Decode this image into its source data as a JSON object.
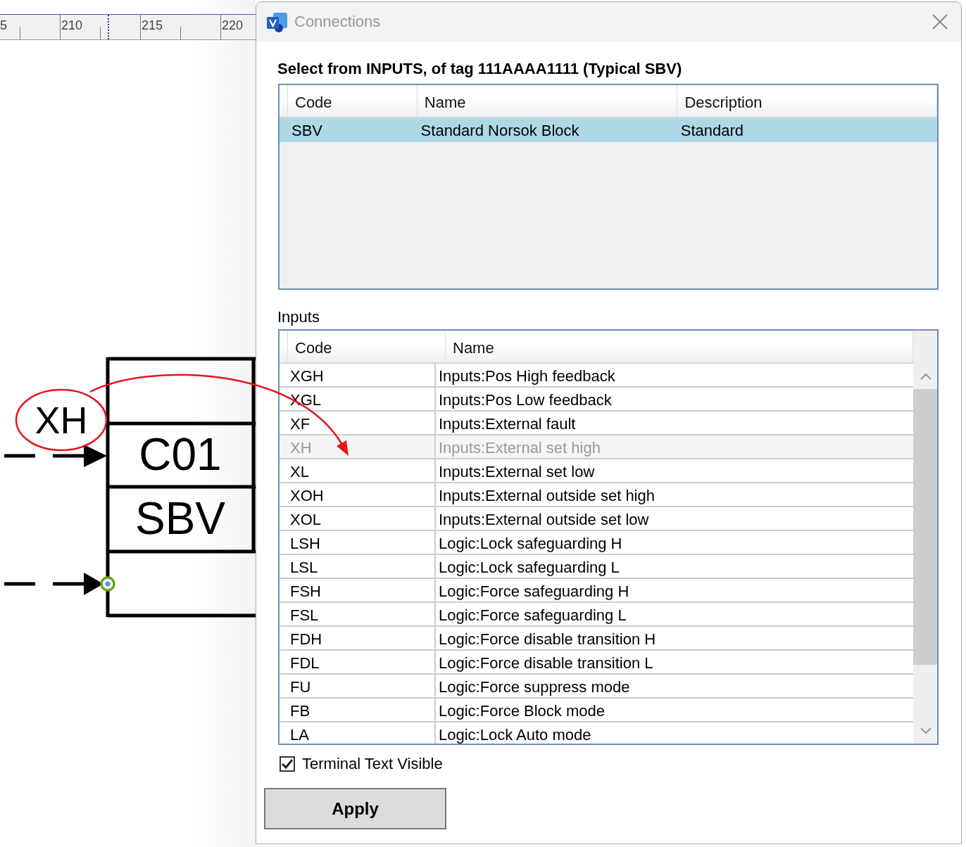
{
  "ruler": {
    "labels": [
      "5",
      "210",
      "215",
      "220"
    ]
  },
  "diagram": {
    "annotation": "XH",
    "block_labels": [
      "C01",
      "SBV"
    ]
  },
  "dialog": {
    "title": "Connections",
    "heading": "Select from INPUTS, of tag 111AAAA1111 (Typical SBV)",
    "typicals": {
      "columns": [
        "Code",
        "Name",
        "Description"
      ],
      "rows": [
        {
          "cells": [
            "SBV",
            "Standard Norsok Block",
            "Standard"
          ],
          "selected": true
        }
      ]
    },
    "inputs": {
      "label": "Inputs",
      "columns": [
        "Code",
        "Name"
      ],
      "rows": [
        {
          "code": "XGH",
          "name": "Inputs:Pos High feedback",
          "disabled": false
        },
        {
          "code": "XGL",
          "name": "Inputs:Pos Low feedback",
          "disabled": false
        },
        {
          "code": "XF",
          "name": "Inputs:External fault",
          "disabled": false
        },
        {
          "code": "XH",
          "name": "Inputs:External set high",
          "disabled": true
        },
        {
          "code": "XL",
          "name": "Inputs:External set low",
          "disabled": false
        },
        {
          "code": "XOH",
          "name": "Inputs:External outside set high",
          "disabled": false
        },
        {
          "code": "XOL",
          "name": "Inputs:External outside set low",
          "disabled": false
        },
        {
          "code": "LSH",
          "name": "Logic:Lock safeguarding H",
          "disabled": false
        },
        {
          "code": "LSL",
          "name": "Logic:Lock safeguarding L",
          "disabled": false
        },
        {
          "code": "FSH",
          "name": "Logic:Force safeguarding H",
          "disabled": false
        },
        {
          "code": "FSL",
          "name": "Logic:Force safeguarding L",
          "disabled": false
        },
        {
          "code": "FDH",
          "name": "Logic:Force disable transition H",
          "disabled": false
        },
        {
          "code": "FDL",
          "name": "Logic:Force disable transition L",
          "disabled": false
        },
        {
          "code": "FU",
          "name": "Logic:Force suppress mode",
          "disabled": false
        },
        {
          "code": "FB",
          "name": "Logic:Force Block mode",
          "disabled": false
        },
        {
          "code": "LA",
          "name": "Logic:Lock Auto mode",
          "disabled": false
        }
      ]
    },
    "terminal_text_visible": {
      "label": "Terminal Text Visible",
      "checked": true
    },
    "apply_button": "Apply"
  }
}
